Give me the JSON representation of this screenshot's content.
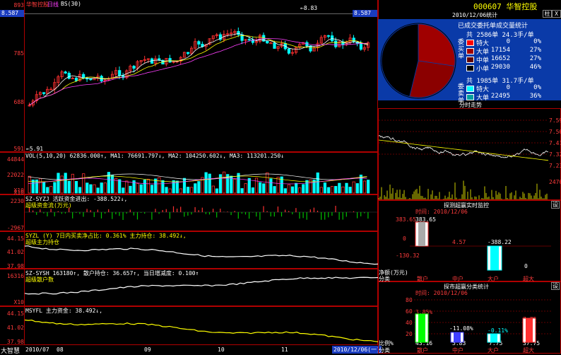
{
  "left": {
    "title": "华智控股",
    "badge": "日线",
    "period": "BS(30)",
    "price_left": "8.587",
    "price_right": "8.587",
    "max_label": "8.83",
    "min_label": "5.91",
    "axis": [
      "893",
      "785",
      "688",
      "591"
    ],
    "vol": {
      "header": "VOL(5,10,20) 62836.000↑, MA1: 76691.797↓, MA2: 104250.602↓, MA3: 113201.250↓",
      "axis": [
        "44844",
        "22022"
      ],
      "unit": "X10"
    },
    "fund_flow": {
      "header": "SZ-SYZJ 活跃资金进出: -388.522↓,",
      "sub": "超级资金流(万元)",
      "axis": [
        "2230",
        "-2967"
      ],
      "unit": "X10"
    },
    "main_hold": {
      "header": "SYZL (Y) 7日内买卖净占比: 0.361% 主力持仓: 38.492↓,",
      "sub": "超级主力持仓",
      "axis": [
        "44.15",
        "41.02",
        "37.98"
      ]
    },
    "retail": {
      "header": "SZ-SYSH 163180↑, 散户持仓: 36.657↑, 当日增减度: 0.100↑",
      "sub": "超级散户数",
      "axis": [
        "16316",
        "X10"
      ]
    },
    "main_fund": {
      "header": "MSYFL 主力资金: 38.492↓,",
      "axis": [
        "44.15",
        "41.02",
        "37.98"
      ]
    },
    "bottom": {
      "brand": "大智慧",
      "months": [
        "2010/07",
        "08",
        "09",
        "10",
        "11"
      ],
      "date": "2010/12/06(一)"
    }
  },
  "right": {
    "code": "000607",
    "name": "华智控股",
    "btn_zhu": "柱",
    "btn_close": "X",
    "stat_title": "2010/12/06统计",
    "pie_title": "已成交委托单成交量统计",
    "pie_chart": {
      "type": "pie",
      "values": [
        0,
        17154,
        16652,
        29030
      ],
      "colors": [
        "#ff0000",
        "#a00000",
        "#8b0000",
        "#000000"
      ]
    },
    "buy_label": "委买单",
    "sell_label": "委卖单",
    "buy_total": "共 2586单 24.3手/单",
    "buy_rows": [
      {
        "color": "#ff0000",
        "label": "特大",
        "value": "0",
        "pct": "0%"
      },
      {
        "color": "#a00000",
        "label": "大单",
        "value": "17154",
        "pct": "27%"
      },
      {
        "color": "#600000",
        "label": "中单",
        "value": "16652",
        "pct": "27%"
      },
      {
        "color": "#000000",
        "label": "小单",
        "value": "29030",
        "pct": "46%"
      }
    ],
    "sell_total": "共 1985单 31.7手/单",
    "sell_rows": [
      {
        "color": "#00ffff",
        "label": "特大",
        "value": "0",
        "pct": "0%"
      },
      {
        "color": "#00a0a0",
        "label": "大单",
        "value": "22495",
        "pct": "36%"
      }
    ],
    "intraday": {
      "title": "分时走势",
      "axis": [
        "7.59",
        "7.50",
        "7.41",
        "7.32",
        "7.23"
      ],
      "vol_axis": "2470"
    },
    "monitor": {
      "title": "探测超赢实时监控",
      "btn": "设",
      "time_label": "时间:",
      "time_value": "2010/12/06",
      "axis": [
        "383.65",
        "0",
        "-130.32"
      ],
      "left_axis": "383.65",
      "bar_labels": [
        "383.65",
        "4.57",
        "-388.22",
        "0"
      ],
      "cats": [
        "散户",
        "中户",
        "大户",
        "超大"
      ],
      "side_label_a": "净额(万元)",
      "side_label_b": "分类"
    },
    "classify": {
      "title": "探市超赢分类统计",
      "btn": "设",
      "time_label": "时间:",
      "time_value": "2010/12/06",
      "axis": [
        "80",
        "60",
        "40",
        "20"
      ],
      "bar_labels": [
        "3.85%",
        "43.16",
        "-11.08%",
        "5.83",
        "-0.11%",
        "7.75",
        "7.75",
        "37.75"
      ],
      "cats": [
        "散户",
        "中户",
        "大户",
        "超大"
      ],
      "side_label_a": "比例%",
      "side_label_b": "分类"
    }
  }
}
